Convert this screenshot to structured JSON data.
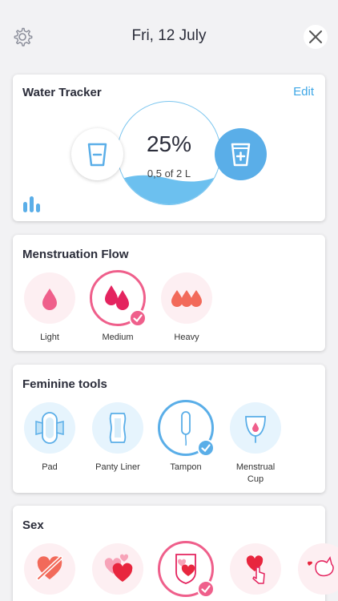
{
  "header": {
    "date": "Fri, 12 July",
    "settings_icon": "gear-icon",
    "close_icon": "close-icon"
  },
  "water": {
    "title": "Water Tracker",
    "edit_label": "Edit",
    "percent": "25%",
    "amount": "0,5 of 2 L",
    "fill_fraction": 0.25,
    "accent": "#5aaee8"
  },
  "flow": {
    "title": "Menstruation Flow",
    "options": [
      {
        "label": "Light",
        "selected": false
      },
      {
        "label": "Medium",
        "selected": true
      },
      {
        "label": "Heavy",
        "selected": false
      }
    ],
    "accent": "#ef5f8b"
  },
  "tools": {
    "title": "Feminine tools",
    "options": [
      {
        "label": "Pad",
        "selected": false
      },
      {
        "label": "Panty Liner",
        "selected": false
      },
      {
        "label": "Tampon",
        "selected": true
      },
      {
        "label": "Menstrual Cup",
        "selected": false
      }
    ]
  },
  "sex": {
    "title": "Sex",
    "options": [
      {
        "icon": "no-heart-icon",
        "selected": false
      },
      {
        "icon": "hearts-icon",
        "selected": false
      },
      {
        "icon": "heart-shield-icon",
        "selected": true
      },
      {
        "icon": "heart-touch-icon",
        "selected": false
      },
      {
        "icon": "toy-icon",
        "selected": false
      }
    ]
  }
}
